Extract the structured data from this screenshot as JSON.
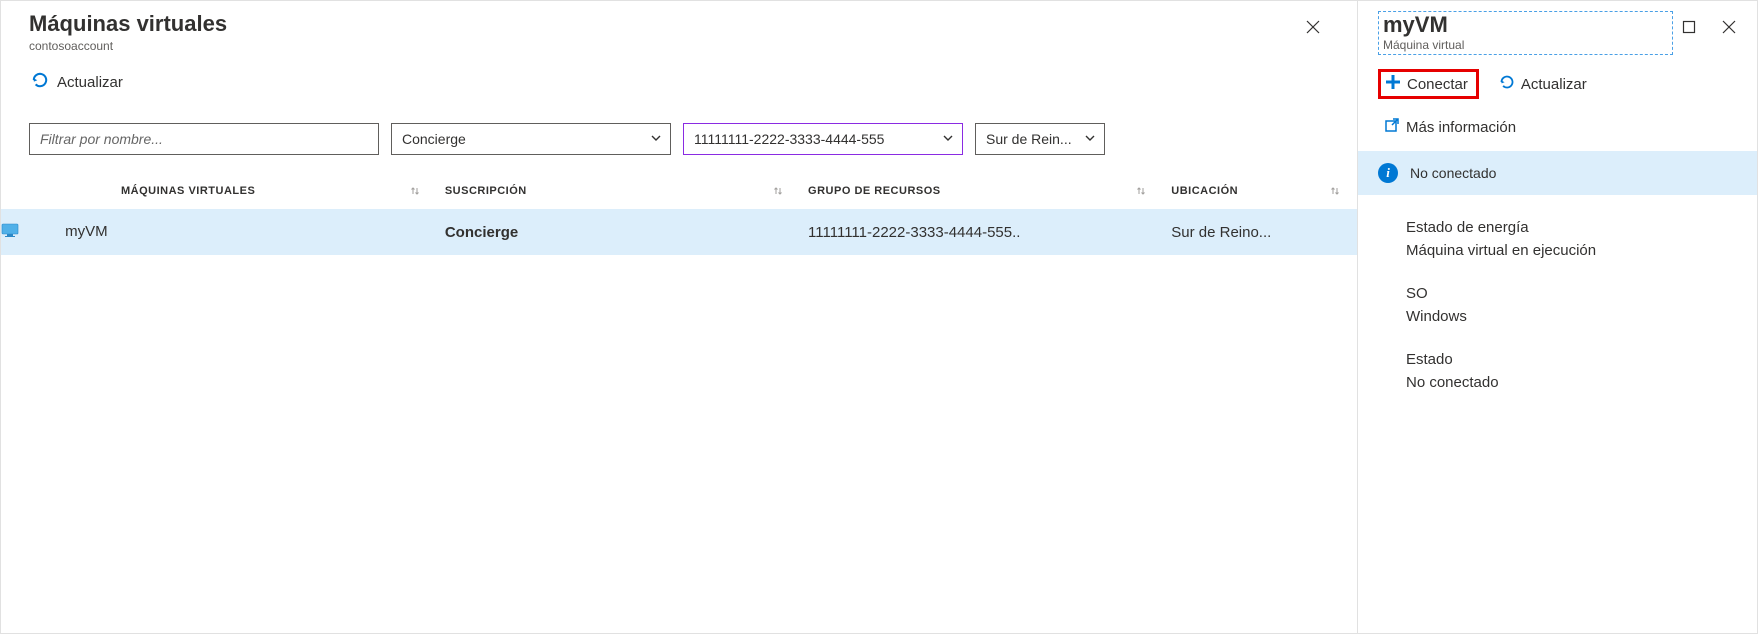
{
  "main": {
    "title": "Máquinas virtuales",
    "subtitle": "contosoaccount",
    "toolbar": {
      "refresh_label": "Actualizar"
    },
    "filters": {
      "name_placeholder": "Filtrar por nombre...",
      "subscription_selected": "Concierge",
      "resource_group_selected": "11111111-2222-3333-4444-555",
      "location_selected": "Sur de Rein..."
    },
    "columns": {
      "vm": "MÁQUINAS VIRTUALES",
      "subscription": "SUSCRIPCIÓN",
      "resource_group": "GRUPO DE RECURSOS",
      "location": "UBICACIÓN"
    },
    "rows": [
      {
        "name": "myVM",
        "subscription": "Concierge",
        "resource_group": "11111111-2222-3333-4444-555..",
        "location": "Sur de Reino..."
      }
    ]
  },
  "detail": {
    "title": "myVM",
    "subtitle": "Máquina virtual",
    "toolbar": {
      "connect_label": "Conectar",
      "refresh_label": "Actualizar",
      "more_info_label": "Más información"
    },
    "status_banner": "No conectado",
    "properties": {
      "power_label": "Estado de energía",
      "power_value": "Máquina virtual en ejecución",
      "os_label": "SO",
      "os_value": "Windows",
      "state_label": "Estado",
      "state_value": "No conectado"
    }
  }
}
